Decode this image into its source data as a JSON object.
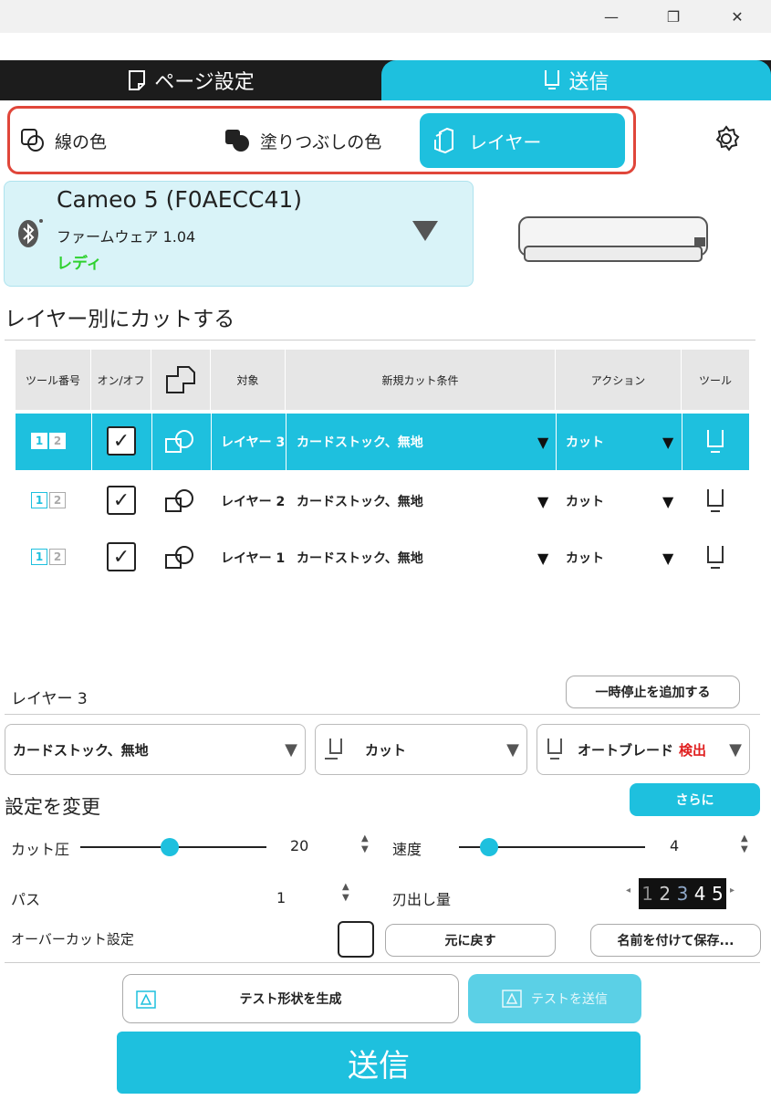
{
  "window": {
    "minimize": "—",
    "restore": "❐",
    "close": "✕"
  },
  "tabs": {
    "page_setup": "ページ設定",
    "send": "送信"
  },
  "segments": {
    "line_color": "線の色",
    "fill_color": "塗りつぶしの色",
    "layer": "レイヤー"
  },
  "device": {
    "name": "Cameo 5 (F0AECC41)",
    "firmware": "ファームウェア 1.04",
    "status": "レディ",
    "status_color": "#2fd12f"
  },
  "section_title": "レイヤー別にカットする",
  "table": {
    "headers": {
      "tool_no": "ツール番号",
      "on_off": "オン/オフ",
      "target": "対象",
      "condition": "新規カット条件",
      "action": "アクション",
      "tool": "ツール"
    },
    "rows": [
      {
        "layer": "レイヤー 3",
        "condition": "カードストック、無地",
        "action": "カット",
        "selected": true
      },
      {
        "layer": "レイヤー 2",
        "condition": "カードストック、無地",
        "action": "カット",
        "selected": false
      },
      {
        "layer": "レイヤー 1",
        "condition": "カードストック、無地",
        "action": "カット",
        "selected": false
      }
    ],
    "tool_nums": [
      "1",
      "2"
    ]
  },
  "layer_panel": {
    "title": "レイヤー 3",
    "add_pause": "一時停止を追加する",
    "material": "カードストック、無地",
    "action": "カット",
    "blade": "オートブレード",
    "blade_status": "検出"
  },
  "settings": {
    "title": "設定を変更",
    "more": "さらに",
    "force_label": "カット圧",
    "force_value": "20",
    "speed_label": "速度",
    "speed_value": "4",
    "passes_label": "パス",
    "passes_value": "1",
    "blade_depth_label": "刃出し量",
    "blade_depth_digits": [
      "1",
      "2",
      "3",
      "4",
      "5"
    ],
    "overcut_label": "オーバーカット設定",
    "revert": "元に戻す",
    "save_as": "名前を付けて保存..."
  },
  "test": {
    "generate": "テスト形状を生成",
    "send_test": "テストを送信"
  },
  "send_button": "送信",
  "accent": "#1ec0de"
}
